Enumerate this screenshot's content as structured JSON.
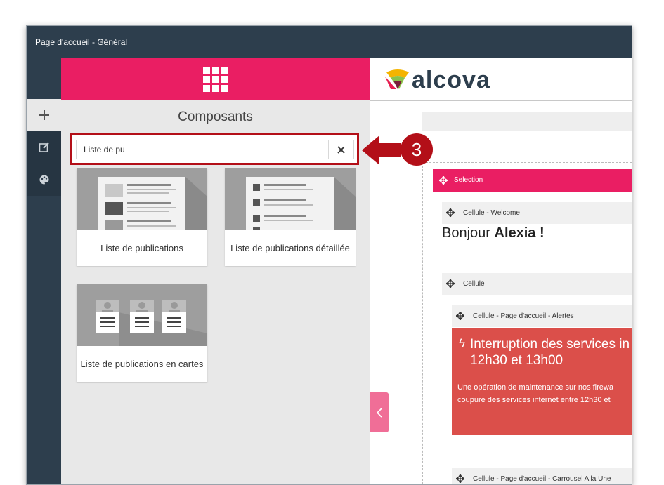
{
  "window": {
    "title": "Page d'accueil - Général"
  },
  "panel": {
    "title": "Composants",
    "search": {
      "value": "Liste de pu"
    },
    "components": [
      {
        "label": "Liste de publications"
      },
      {
        "label": "Liste de publications détaillée"
      },
      {
        "label": "Liste de publications en cartes"
      }
    ]
  },
  "content": {
    "logo": "alcova",
    "selection_label": "Selection",
    "cells": {
      "welcome": "Cellule - Welcome",
      "cell": "Cellule",
      "alerts": "Cellule - Page d'accueil - Alertes",
      "carousel": "Cellule - Page d'accueil - Carrousel A la Une"
    },
    "greeting_prefix": "Bonjour ",
    "greeting_name": "Alexia !",
    "alert": {
      "title": "Interruption des services in\n12h30 et 13h00",
      "text": "Une opération de maintenance sur nos firewa\ncoupure des services internet entre 12h30 et"
    }
  },
  "callout": {
    "step": "3"
  },
  "colors": {
    "accent": "#ea1e63",
    "sidebar": "#2d3e4d",
    "alert": "#db4f4a",
    "callout": "#b30f18"
  }
}
